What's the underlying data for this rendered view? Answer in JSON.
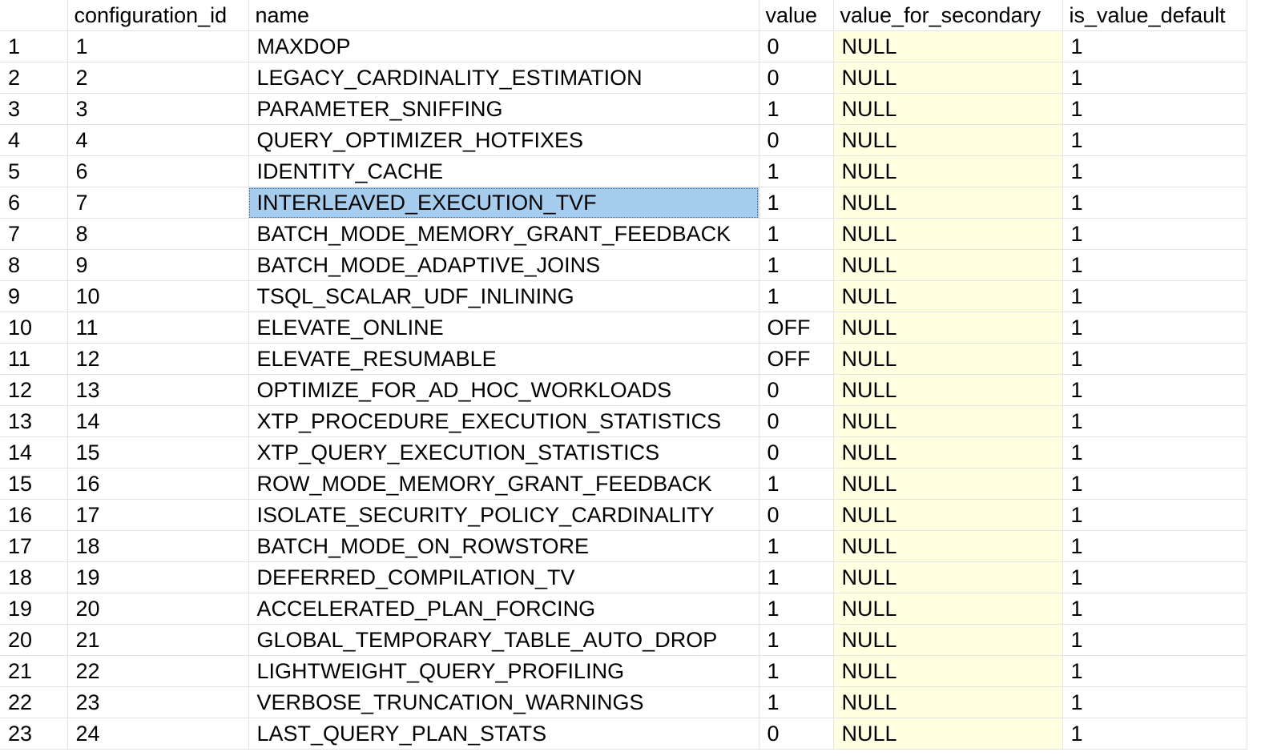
{
  "grid": {
    "columns": [
      "",
      "configuration_id",
      "name",
      "value",
      "value_for_secondary",
      "is_value_default"
    ],
    "selected_cell": {
      "row": 6,
      "column": "name"
    },
    "secondary_column_color": "#ffffe1",
    "selection_color": "#a6cdee",
    "rows": [
      {
        "row": "1",
        "configuration_id": "1",
        "name": "MAXDOP",
        "value": "0",
        "value_for_secondary": "NULL",
        "is_value_default": "1"
      },
      {
        "row": "2",
        "configuration_id": "2",
        "name": "LEGACY_CARDINALITY_ESTIMATION",
        "value": "0",
        "value_for_secondary": "NULL",
        "is_value_default": "1"
      },
      {
        "row": "3",
        "configuration_id": "3",
        "name": "PARAMETER_SNIFFING",
        "value": "1",
        "value_for_secondary": "NULL",
        "is_value_default": "1"
      },
      {
        "row": "4",
        "configuration_id": "4",
        "name": "QUERY_OPTIMIZER_HOTFIXES",
        "value": "0",
        "value_for_secondary": "NULL",
        "is_value_default": "1"
      },
      {
        "row": "5",
        "configuration_id": "6",
        "name": "IDENTITY_CACHE",
        "value": "1",
        "value_for_secondary": "NULL",
        "is_value_default": "1"
      },
      {
        "row": "6",
        "configuration_id": "7",
        "name": "INTERLEAVED_EXECUTION_TVF",
        "value": "1",
        "value_for_secondary": "NULL",
        "is_value_default": "1"
      },
      {
        "row": "7",
        "configuration_id": "8",
        "name": "BATCH_MODE_MEMORY_GRANT_FEEDBACK",
        "value": "1",
        "value_for_secondary": "NULL",
        "is_value_default": "1"
      },
      {
        "row": "8",
        "configuration_id": "9",
        "name": "BATCH_MODE_ADAPTIVE_JOINS",
        "value": "1",
        "value_for_secondary": "NULL",
        "is_value_default": "1"
      },
      {
        "row": "9",
        "configuration_id": "10",
        "name": "TSQL_SCALAR_UDF_INLINING",
        "value": "1",
        "value_for_secondary": "NULL",
        "is_value_default": "1"
      },
      {
        "row": "10",
        "configuration_id": "11",
        "name": "ELEVATE_ONLINE",
        "value": "OFF",
        "value_for_secondary": "NULL",
        "is_value_default": "1"
      },
      {
        "row": "11",
        "configuration_id": "12",
        "name": "ELEVATE_RESUMABLE",
        "value": "OFF",
        "value_for_secondary": "NULL",
        "is_value_default": "1"
      },
      {
        "row": "12",
        "configuration_id": "13",
        "name": "OPTIMIZE_FOR_AD_HOC_WORKLOADS",
        "value": "0",
        "value_for_secondary": "NULL",
        "is_value_default": "1"
      },
      {
        "row": "13",
        "configuration_id": "14",
        "name": "XTP_PROCEDURE_EXECUTION_STATISTICS",
        "value": "0",
        "value_for_secondary": "NULL",
        "is_value_default": "1"
      },
      {
        "row": "14",
        "configuration_id": "15",
        "name": "XTP_QUERY_EXECUTION_STATISTICS",
        "value": "0",
        "value_for_secondary": "NULL",
        "is_value_default": "1"
      },
      {
        "row": "15",
        "configuration_id": "16",
        "name": "ROW_MODE_MEMORY_GRANT_FEEDBACK",
        "value": "1",
        "value_for_secondary": "NULL",
        "is_value_default": "1"
      },
      {
        "row": "16",
        "configuration_id": "17",
        "name": "ISOLATE_SECURITY_POLICY_CARDINALITY",
        "value": "0",
        "value_for_secondary": "NULL",
        "is_value_default": "1"
      },
      {
        "row": "17",
        "configuration_id": "18",
        "name": "BATCH_MODE_ON_ROWSTORE",
        "value": "1",
        "value_for_secondary": "NULL",
        "is_value_default": "1"
      },
      {
        "row": "18",
        "configuration_id": "19",
        "name": "DEFERRED_COMPILATION_TV",
        "value": "1",
        "value_for_secondary": "NULL",
        "is_value_default": "1"
      },
      {
        "row": "19",
        "configuration_id": "20",
        "name": "ACCELERATED_PLAN_FORCING",
        "value": "1",
        "value_for_secondary": "NULL",
        "is_value_default": "1"
      },
      {
        "row": "20",
        "configuration_id": "21",
        "name": "GLOBAL_TEMPORARY_TABLE_AUTO_DROP",
        "value": "1",
        "value_for_secondary": "NULL",
        "is_value_default": "1"
      },
      {
        "row": "21",
        "configuration_id": "22",
        "name": "LIGHTWEIGHT_QUERY_PROFILING",
        "value": "1",
        "value_for_secondary": "NULL",
        "is_value_default": "1"
      },
      {
        "row": "22",
        "configuration_id": "23",
        "name": "VERBOSE_TRUNCATION_WARNINGS",
        "value": "1",
        "value_for_secondary": "NULL",
        "is_value_default": "1"
      },
      {
        "row": "23",
        "configuration_id": "24",
        "name": "LAST_QUERY_PLAN_STATS",
        "value": "0",
        "value_for_secondary": "NULL",
        "is_value_default": "1"
      }
    ]
  }
}
